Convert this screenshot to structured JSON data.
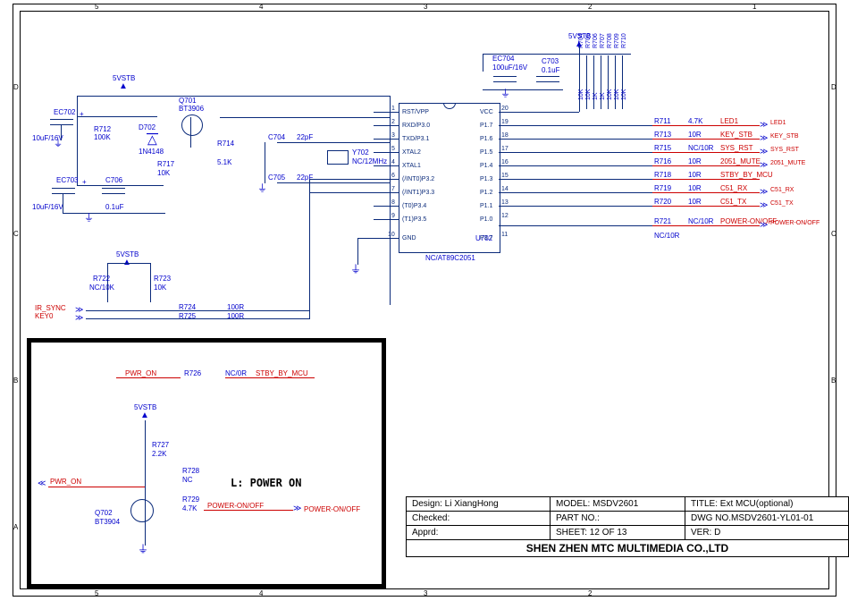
{
  "frame": {
    "cols_top": [
      "5",
      "4",
      "3",
      "2",
      "1"
    ],
    "cols_bottom": [
      "5",
      "4",
      "3",
      "2"
    ],
    "rows": [
      "D",
      "C",
      "B",
      "A"
    ]
  },
  "title_block": {
    "design": "Design: Li XiangHong",
    "model": "MODEL: MSDV2601",
    "title": "TITLE:  Ext MCU(optional)",
    "checked": "Checked:",
    "partno": "PART NO.:",
    "dwgno": "DWG NO.MSDV2601-YL01-01",
    "apprd": "Apprd:",
    "sheet": "SHEET:  12  OF  13",
    "ver": "VER: D",
    "company": "SHEN ZHEN MTC MULTIMEDIA CO.,LTD"
  },
  "power_rails": {
    "main_top": "5VSTB",
    "left_top": "5VSTB",
    "left_mid": "5VSTB",
    "inset": "5VSTB"
  },
  "ic_u702": {
    "ref": "U702",
    "part": "NC/AT89C2051",
    "pins_left": [
      {
        "num": "1",
        "name": "RST/VPP"
      },
      {
        "num": "2",
        "name": "RXD/P3.0"
      },
      {
        "num": "3",
        "name": "TXD/P3.1"
      },
      {
        "num": "5",
        "name": "XTAL2"
      },
      {
        "num": "4",
        "name": "XTAL1"
      },
      {
        "num": "6",
        "name": "(/INT0)P3.2"
      },
      {
        "num": "7",
        "name": "(/INT1)P3.3"
      },
      {
        "num": "8",
        "name": "(T0)P3.4"
      },
      {
        "num": "9",
        "name": "(T1)P3.5"
      },
      {
        "num": "10",
        "name": "GND"
      }
    ],
    "pins_right": [
      {
        "num": "20",
        "name": "VCC"
      },
      {
        "num": "19",
        "name": "P1.7"
      },
      {
        "num": "18",
        "name": "P1.6"
      },
      {
        "num": "17",
        "name": "P1.5"
      },
      {
        "num": "16",
        "name": "P1.4"
      },
      {
        "num": "15",
        "name": "P1.3"
      },
      {
        "num": "14",
        "name": "P1.2"
      },
      {
        "num": "13",
        "name": "P1.1"
      },
      {
        "num": "12",
        "name": "P1.0"
      },
      {
        "num": "11",
        "name": "P3.7"
      }
    ]
  },
  "caps": {
    "EC702": {
      "ref": "EC702",
      "val": "10uF/16V"
    },
    "EC703": {
      "ref": "EC703",
      "val": "10uF/16V"
    },
    "EC704": {
      "ref": "EC704",
      "val": "100uF/16V"
    },
    "C703": {
      "ref": "C703",
      "val": "0.1uF"
    },
    "C704": {
      "ref": "C704",
      "val": "22pF"
    },
    "C705": {
      "ref": "C705",
      "val": "22pF"
    },
    "C706": {
      "ref": "C706",
      "val": "0.1uF"
    }
  },
  "res": {
    "R712": {
      "ref": "R712",
      "val": "100K"
    },
    "R714": {
      "ref": "R714",
      "val": "5.1K"
    },
    "R717": {
      "ref": "R717",
      "val": "10K"
    },
    "R722": {
      "ref": "R722",
      "val": "NC/10K"
    },
    "R723": {
      "ref": "R723",
      "val": "10K"
    },
    "R724": {
      "ref": "R724",
      "val": "100R"
    },
    "R725": {
      "ref": "R725",
      "val": "100R"
    },
    "R711": {
      "ref": "R711",
      "val": "4.7K"
    },
    "R713": {
      "ref": "R713",
      "val": "10R"
    },
    "R715": {
      "ref": "R715",
      "val": "NC/10R"
    },
    "R716": {
      "ref": "R716",
      "val": "10R"
    },
    "R718": {
      "ref": "R718",
      "val": "10R"
    },
    "R719": {
      "ref": "R719",
      "val": "10R"
    },
    "R720": {
      "ref": "R720",
      "val": "10R"
    },
    "R721": {
      "ref": "R721",
      "val": "NC/10R"
    },
    "R726": {
      "ref": "R726",
      "val": "NC/0R"
    },
    "R727": {
      "ref": "R727",
      "val": "2.2K"
    },
    "R728": {
      "ref": "R728",
      "val": "NC"
    },
    "R729": {
      "ref": "R729",
      "val": "4.7K"
    },
    "array": [
      {
        "ref": "R704",
        "val": "10K"
      },
      {
        "ref": "R705",
        "val": "10K"
      },
      {
        "ref": "R706",
        "val": "1K"
      },
      {
        "ref": "R707",
        "val": "1K"
      },
      {
        "ref": "R708",
        "val": "10K"
      },
      {
        "ref": "R709",
        "val": "10K"
      },
      {
        "ref": "R710",
        "val": "10K"
      }
    ]
  },
  "diode": {
    "ref": "D702",
    "val": "1N4148"
  },
  "q": {
    "Q701": {
      "ref": "Q701",
      "val": "BT3906"
    },
    "Q702": {
      "ref": "Q702",
      "val": "BT3904"
    }
  },
  "xtal": {
    "ref": "Y702",
    "val": "NC/12MHz"
  },
  "nets_left": {
    "ir": "IR_SYNC",
    "key": "KEY0"
  },
  "nets_right": [
    {
      "sig": "LED1",
      "port": "LED1"
    },
    {
      "sig": "KEY_STB",
      "port": "KEY_STB"
    },
    {
      "sig": "SYS_RST",
      "port": "SYS_RST"
    },
    {
      "sig": "2051_MUTE",
      "port": "2051_MUTE"
    },
    {
      "sig": "STBY_BY_MCU",
      "port": ""
    },
    {
      "sig": "C51_RX",
      "port": "C51_RX"
    },
    {
      "sig": "C51_TX",
      "port": "C51_TX"
    },
    {
      "sig": "POWER-ON/OFF",
      "port": "POWER-ON/OFF"
    }
  ],
  "inset": {
    "heading": "L:  POWER ON",
    "pwr_on_a": "PWR_ON",
    "pwr_on_b": "PWR_ON",
    "stby": "STBY_BY_MCU",
    "pon": "POWER-ON/OFF",
    "pon2": "POWER-ON/OFF"
  }
}
